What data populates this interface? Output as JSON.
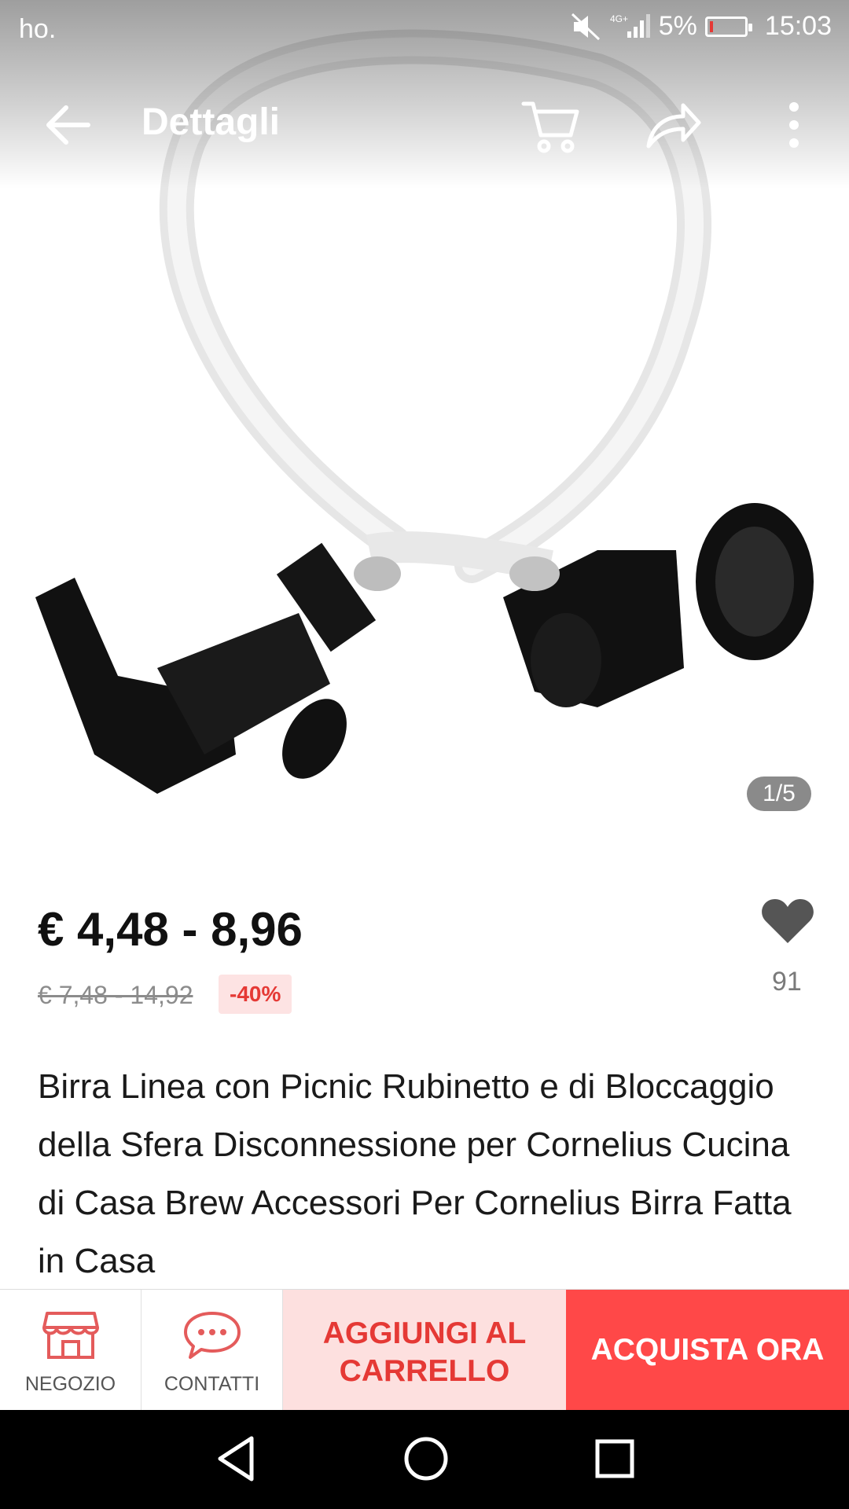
{
  "status_bar": {
    "carrier": "ho.",
    "network": "4G+",
    "battery": "5%",
    "time": "15:03"
  },
  "app_bar": {
    "title": "Dettagli"
  },
  "gallery": {
    "counter": "1/5"
  },
  "product": {
    "price": "€ 4,48 - 8,96",
    "old_price": "€ 7,48 - 14,92",
    "discount": "-40%",
    "wishlist_count": "91",
    "title": "Birra Linea con Picnic Rubinetto e di Bloccaggio della Sfera Disconnessione per Cornelius Cucina di Casa Brew Accessori Per Cornelius Birra Fatta in Casa"
  },
  "actions": {
    "store_label": "NEGOZIO",
    "contact_label": "CONTATTI",
    "add_to_cart_label": "AGGIUNGI AL CARRELLO",
    "buy_now_label": "ACQUISTA ORA"
  },
  "icons": {
    "back": "arrow-left-icon",
    "cart": "cart-icon",
    "share": "share-icon",
    "more": "more-vert-icon",
    "wishlist": "heart-icon",
    "store": "store-icon",
    "contact": "chat-bubble-icon"
  },
  "colors": {
    "accent": "#ff4848",
    "accent_light": "#fde0df",
    "discount_text": "#e53935"
  }
}
